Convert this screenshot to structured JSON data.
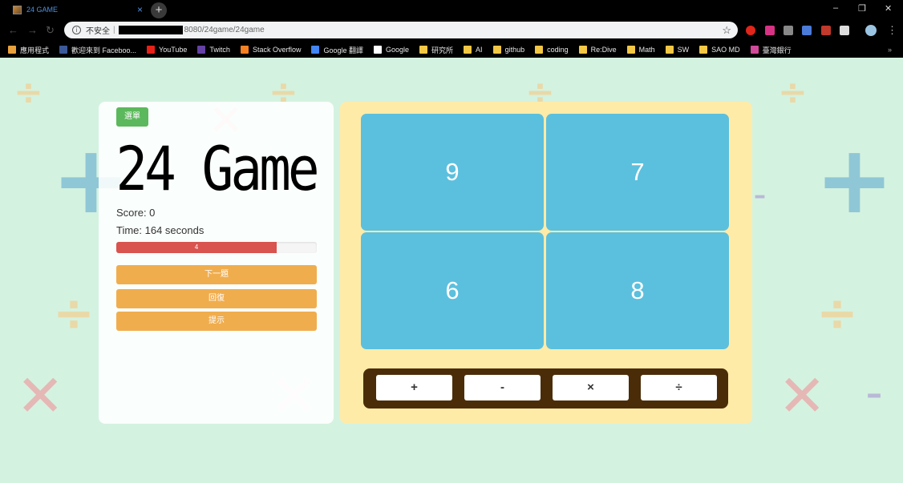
{
  "browser": {
    "tab_title": "24 GAME",
    "tab_close": "×",
    "new_tab": "+",
    "window_controls": {
      "minimize": "–",
      "restore": "❐",
      "close": "✕"
    },
    "nav": {
      "back": "←",
      "forward": "→",
      "reload": "↻"
    },
    "security_label": "不安全",
    "separator": "|",
    "url": "8080/24game/24game",
    "star_icon": "☆",
    "menu_icon": "⋮",
    "bookmarks": [
      {
        "label": "應用程式",
        "icon": "apps-grid-icon",
        "color": "#e8a13c"
      },
      {
        "label": "歡迎來到 Faceboo...",
        "icon": "facebook-icon",
        "color": "#3b5998"
      },
      {
        "label": "YouTube",
        "icon": "youtube-icon",
        "color": "#e62117"
      },
      {
        "label": "Twitch",
        "icon": "twitch-icon",
        "color": "#6441a4"
      },
      {
        "label": "Stack Overflow",
        "icon": "stackoverflow-icon",
        "color": "#f48024"
      },
      {
        "label": "Google 翻譯",
        "icon": "google-translate-icon",
        "color": "#4285f4"
      },
      {
        "label": "Google",
        "icon": "google-icon",
        "color": "#ffffff"
      },
      {
        "label": "研究所",
        "icon": "folder-icon",
        "color": "#f2c744"
      },
      {
        "label": "AI",
        "icon": "folder-icon",
        "color": "#f2c744"
      },
      {
        "label": "github",
        "icon": "folder-icon",
        "color": "#f2c744"
      },
      {
        "label": "coding",
        "icon": "folder-icon",
        "color": "#f2c744"
      },
      {
        "label": "Re:Dive",
        "icon": "folder-icon",
        "color": "#f2c744"
      },
      {
        "label": "Math",
        "icon": "folder-icon",
        "color": "#f2c744"
      },
      {
        "label": "SW",
        "icon": "folder-icon",
        "color": "#f2c744"
      },
      {
        "label": "SAO MD",
        "icon": "folder-icon",
        "color": "#f2c744"
      },
      {
        "label": "臺灣銀行",
        "icon": "bank-icon",
        "color": "#d04a9a"
      }
    ],
    "bookmarks_more": "»"
  },
  "game": {
    "menu_label": "選單",
    "title": "24 Game",
    "score_text": "Score: 0",
    "time_text": "Time: 164 seconds",
    "progress_label": "4",
    "progress_fraction": 0.8,
    "next_label": "下一題",
    "restore_label": "回復",
    "hint_label": "提示",
    "cards": [
      "9",
      "7",
      "6",
      "8"
    ],
    "operators": [
      "+",
      "-",
      "×",
      "÷"
    ]
  },
  "colors": {
    "background": "#d4f2e0",
    "menu_button": "#5cb85c",
    "action_button": "#f0ad4e",
    "progress": "#d9534f",
    "card": "#5bc0de",
    "board": "#ffeba8",
    "operator_bar": "#4a2d08"
  }
}
